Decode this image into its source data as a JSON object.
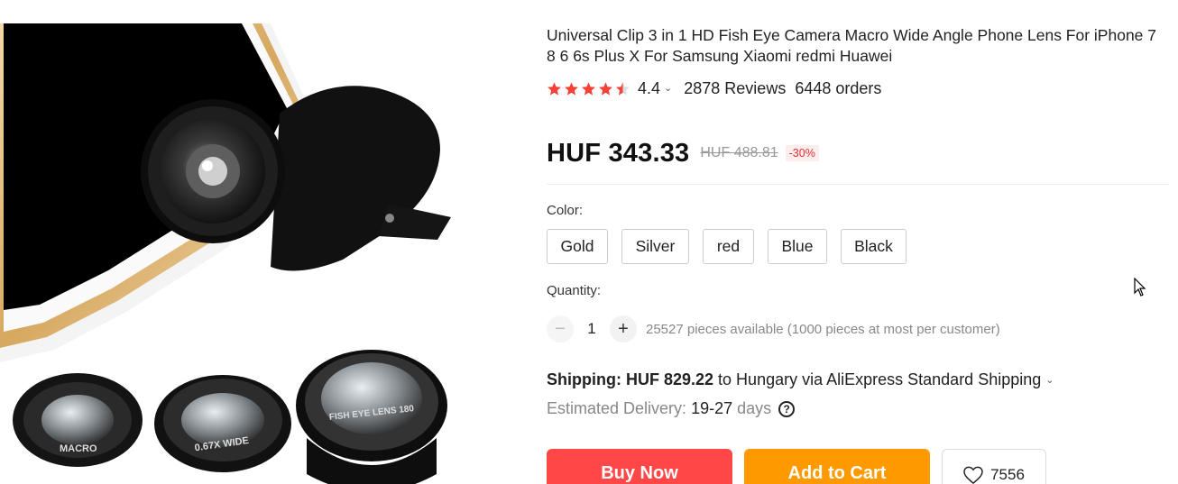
{
  "product": {
    "title": "Universal Clip 3 in 1 HD Fish Eye Camera Macro Wide Angle Phone Lens For iPhone 7 8 6 6s Plus X For Samsung Xiaomi redmi Huawei",
    "rating": "4.4",
    "rating_stars": 4.4,
    "reviews": "2878 Reviews",
    "orders": "6448 orders",
    "star_color": "#f44336"
  },
  "price": {
    "current": "HUF 343.33",
    "original": "HUF 488.81",
    "discount": "-30%"
  },
  "color": {
    "label": "Color:",
    "options": [
      "Gold",
      "Silver",
      "red",
      "Blue",
      "Black"
    ]
  },
  "quantity": {
    "label": "Quantity:",
    "value": "1",
    "minus_icon": "minus-icon",
    "plus_icon": "plus-icon",
    "available": "25527 pieces available (1000 pieces at most per customer)"
  },
  "shipping": {
    "label": "Shipping:",
    "cost": "HUF 829.22",
    "destination": "to Hungary via AliExpress Standard Shipping",
    "delivery_label": "Estimated Delivery:",
    "delivery_dates": "19-27",
    "delivery_unit": "days"
  },
  "actions": {
    "buy_now": "Buy Now",
    "add_to_cart": "Add to Cart",
    "wishlist_count": "7556",
    "buy_color": "#ff4747",
    "cart_color": "#ff9900"
  },
  "image": {
    "lens_labels": [
      "MACRO",
      "0.67X WIDE",
      "FISH EYE LENS 180"
    ]
  }
}
